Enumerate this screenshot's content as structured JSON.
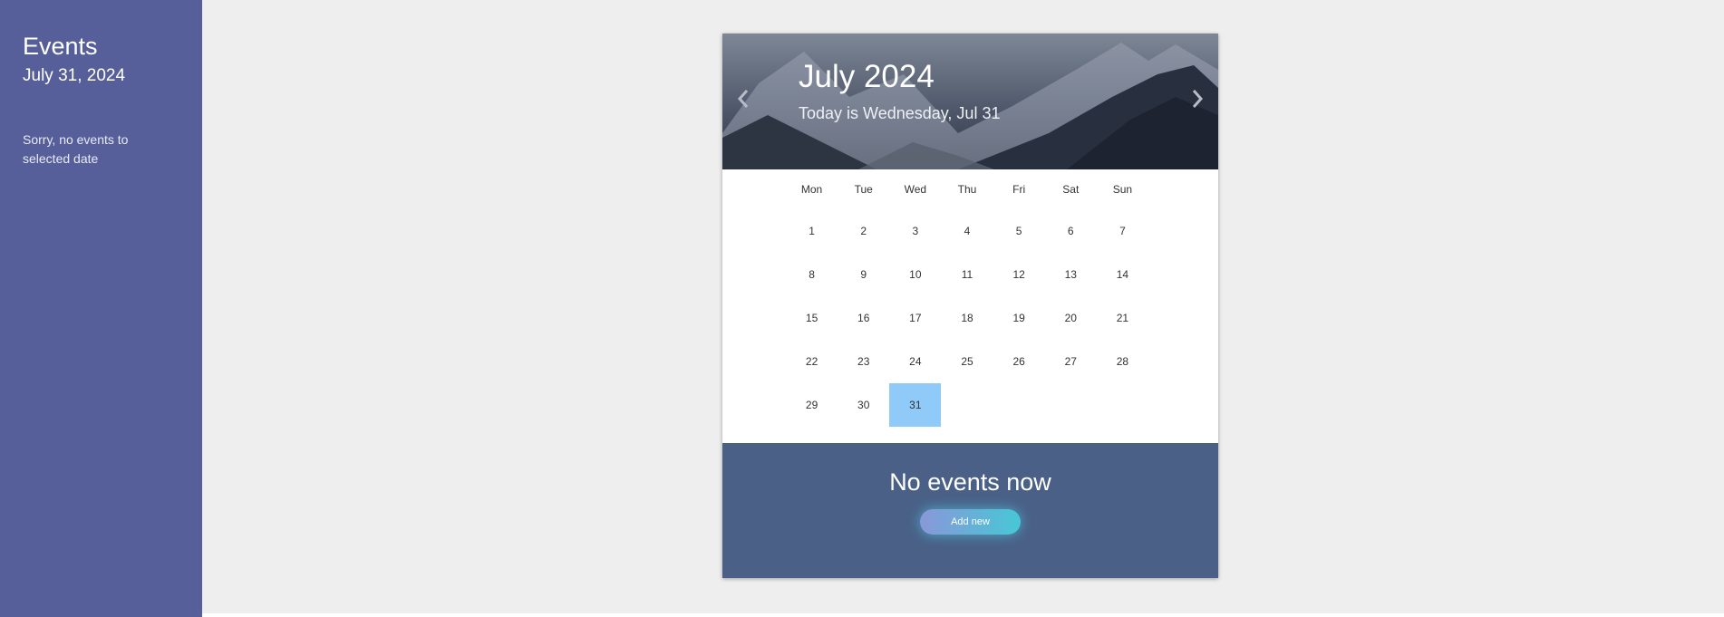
{
  "sidebar": {
    "title": "Events",
    "date": "July 31, 2024",
    "empty_message": "Sorry, no events to selected date"
  },
  "header": {
    "month_title": "July 2024",
    "today_text": "Today is Wednesday, Jul 31",
    "prev_icon": "chevron-left-icon",
    "next_icon": "chevron-right-icon"
  },
  "weekdays": [
    "Mon",
    "Tue",
    "Wed",
    "Thu",
    "Fri",
    "Sat",
    "Sun"
  ],
  "weeks": [
    [
      "1",
      "2",
      "3",
      "4",
      "5",
      "6",
      "7"
    ],
    [
      "8",
      "9",
      "10",
      "11",
      "12",
      "13",
      "14"
    ],
    [
      "15",
      "16",
      "17",
      "18",
      "19",
      "20",
      "21"
    ],
    [
      "22",
      "23",
      "24",
      "25",
      "26",
      "27",
      "28"
    ],
    [
      "29",
      "30",
      "31",
      "",
      "",
      "",
      ""
    ]
  ],
  "selected_day": "31",
  "footer": {
    "message": "No events now",
    "add_button": "Add new"
  },
  "colors": {
    "sidebar": "#565f99",
    "footer": "#4a6087",
    "selected_day": "#90caf9",
    "page_background": "#eeeeee"
  }
}
